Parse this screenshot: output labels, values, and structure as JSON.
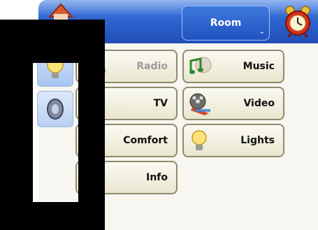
{
  "header": {
    "room_label": "Room"
  },
  "sidebar": {
    "items": [
      {
        "name": "lights-icon"
      },
      {
        "name": "speaker-icon"
      }
    ]
  },
  "tiles": [
    {
      "label": "Radio"
    },
    {
      "label": "Music"
    },
    {
      "label": "TV"
    },
    {
      "label": "Video"
    },
    {
      "label": "Comfort"
    },
    {
      "label": "Lights"
    },
    {
      "label": "Info"
    }
  ]
}
